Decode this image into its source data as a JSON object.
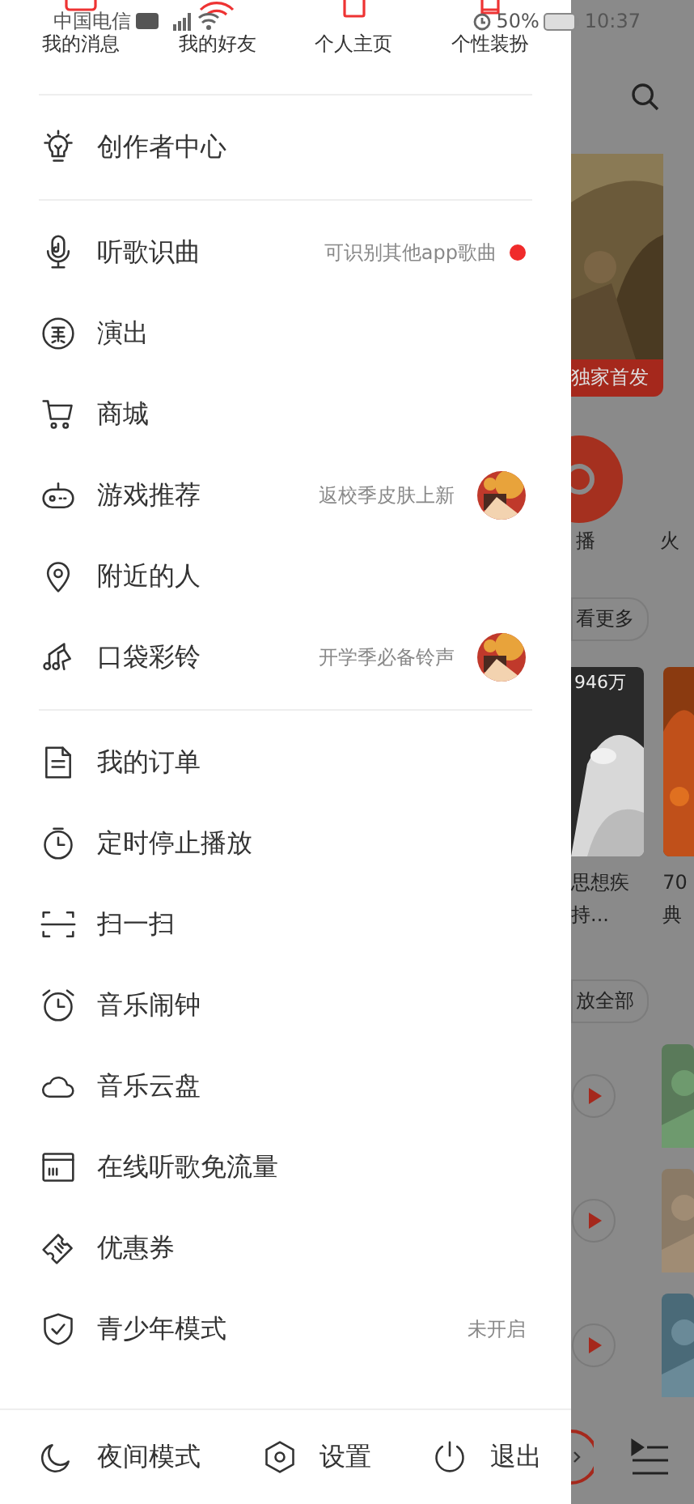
{
  "status_bar": {
    "carrier": "中国电信",
    "battery": "50%",
    "time": "10:37"
  },
  "drawer": {
    "shortcuts": [
      {
        "label": "我的消息"
      },
      {
        "label": "我的好友"
      },
      {
        "label": "个人主页"
      },
      {
        "label": "个性装扮"
      }
    ],
    "sections": [
      {
        "items": [
          {
            "label": "创作者中心"
          }
        ]
      },
      {
        "items": [
          {
            "label": "听歌识曲",
            "hint": "可识别其他app歌曲",
            "dot": true
          },
          {
            "label": "演出"
          },
          {
            "label": "商城"
          },
          {
            "label": "游戏推荐",
            "hint": "返校季皮肤上新"
          },
          {
            "label": "附近的人"
          },
          {
            "label": "口袋彩铃",
            "hint": "开学季必备铃声"
          }
        ]
      },
      {
        "items": [
          {
            "label": "我的订单"
          },
          {
            "label": "定时停止播放"
          },
          {
            "label": "扫一扫"
          },
          {
            "label": "音乐闹钟"
          },
          {
            "label": "音乐云盘"
          },
          {
            "label": "在线听歌免流量"
          },
          {
            "label": "优惠券"
          },
          {
            "label": "青少年模式",
            "hint": "未开启"
          }
        ]
      }
    ],
    "footer": [
      {
        "label": "夜间模式"
      },
      {
        "label": "设置"
      },
      {
        "label": "退出"
      }
    ]
  },
  "background": {
    "banner_tag": "独家首发",
    "icon_labels": [
      "播",
      "火"
    ],
    "more_button": "看更多",
    "play_count": "946万",
    "card_titles": [
      [
        "思想疾",
        "持..."
      ],
      [
        "70",
        "典"
      ]
    ],
    "play_all_button": "放全部"
  }
}
